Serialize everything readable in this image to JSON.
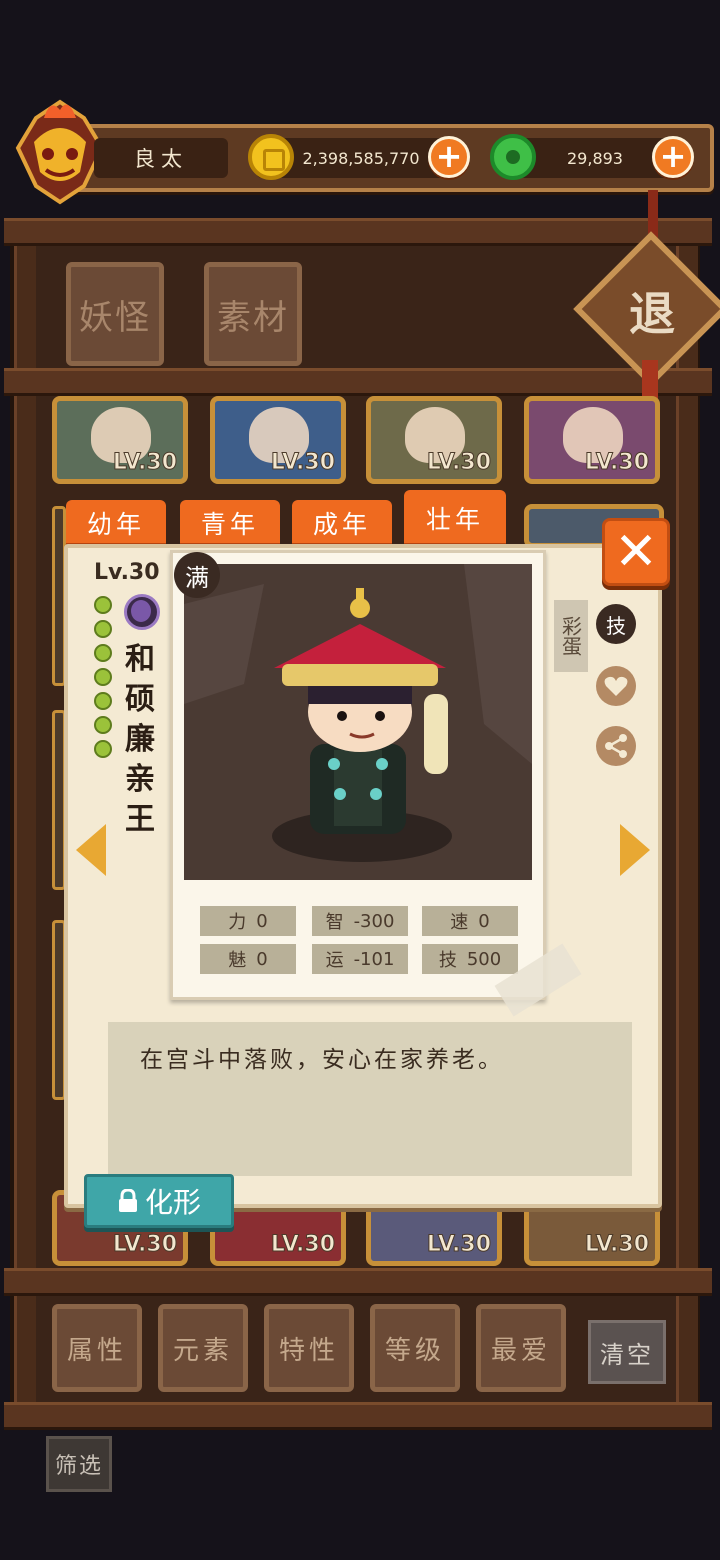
{
  "header": {
    "player_name": "良太",
    "coins": "2,398,585,770",
    "jade": "29,893",
    "plus_symbol": "+"
  },
  "top_tabs": [
    "妖怪",
    "素材"
  ],
  "exit_label": "退",
  "card_level_label": "LV.30",
  "age_tabs": [
    "幼年",
    "青年",
    "成年",
    "壮年"
  ],
  "active_age_tab": "壮年",
  "detail": {
    "level": "Lv.30",
    "full_badge": "满",
    "name": [
      "和",
      "硕",
      "廉",
      "亲",
      "王"
    ],
    "easter_egg": "彩蛋",
    "skill_icon_label": "技",
    "stats": [
      {
        "label": "力",
        "value": "0"
      },
      {
        "label": "智",
        "value": "-300"
      },
      {
        "label": "速",
        "value": "0"
      },
      {
        "label": "魅",
        "value": "0"
      },
      {
        "label": "运",
        "value": "-101"
      },
      {
        "label": "技",
        "value": "500"
      }
    ],
    "description": "在宫斗中落败，安心在家养老。",
    "transform_button": "化形",
    "close_symbol": "✕"
  },
  "bottom_filters": [
    "属性",
    "元素",
    "特性",
    "等级",
    "最爱"
  ],
  "clear_button": "清空",
  "screen_button": "筛选"
}
